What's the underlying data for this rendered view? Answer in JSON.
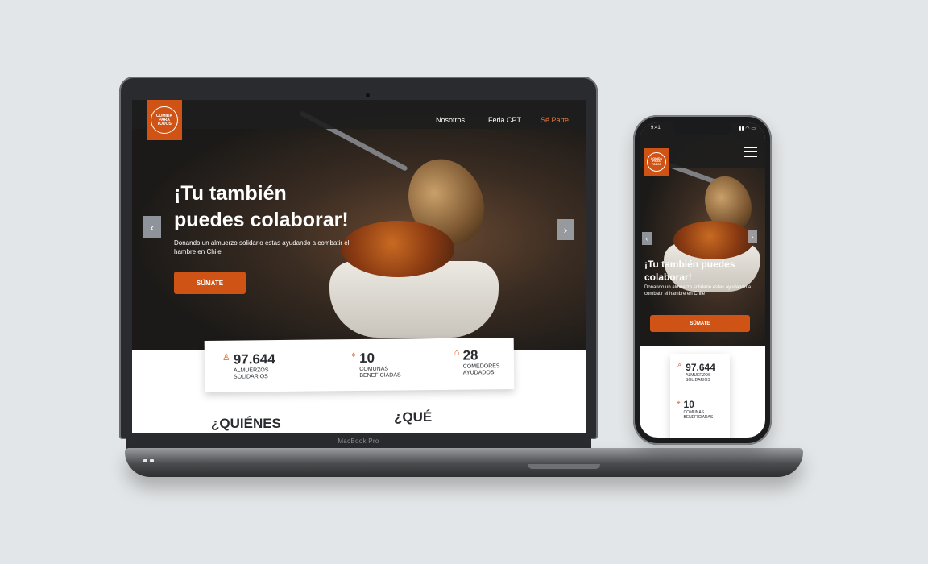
{
  "site": {
    "logo_text": "COMIDA PARA TODOS",
    "brand_color": "#d05316",
    "accent_color": "#e8773a"
  },
  "nav": {
    "items": [
      "Nosotros",
      "Feria CPT",
      "Sé Parte"
    ]
  },
  "hero": {
    "title_desktop_line1": "¡Tu también",
    "title_desktop_line2": "puedes colaborar!",
    "title_mobile_line1": "¡Tu también puedes",
    "title_mobile_line2": "colaborar!",
    "subtitle": "Donando un almuerzo solidario estas ayudando a combatir el hambre en Chile",
    "cta_label": "SÚMATE",
    "prev_icon": "chevron-left-icon",
    "next_icon": "chevron-right-icon"
  },
  "stats": [
    {
      "icon": "person-icon",
      "value": "97.644",
      "label": "ALMUERZOS SOLIDARIOS"
    },
    {
      "icon": "location-pin-icon",
      "value": "10",
      "label": "COMUNAS BENEFICIADAS"
    },
    {
      "icon": "house-icon",
      "value": "28",
      "label": "COMEDORES AYUDADOS"
    }
  ],
  "sections": {
    "quienes": "¿QUIÉNES",
    "que": "¿QUÉ"
  },
  "device": {
    "laptop_label": "MacBook Pro",
    "phone_time": "9:41"
  }
}
